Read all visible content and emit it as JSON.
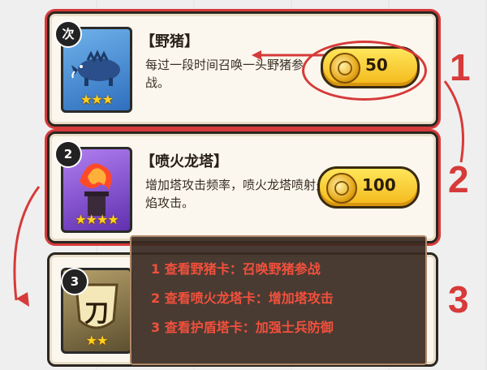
{
  "cards": [
    {
      "badge": "次",
      "title": "【野猪】",
      "desc": "每过一段时间召唤一头野猪参战。",
      "price": "50",
      "stars": "★★★",
      "step_number": "1"
    },
    {
      "badge": "2",
      "title": "【喷火龙塔】",
      "desc": "增加塔攻击频率，喷火龙塔喷射火焰攻击。",
      "price": "100",
      "stars": "★★★★",
      "step_number": "2"
    },
    {
      "badge": "3",
      "portrait_glyph": "刀",
      "stars": "★★",
      "step_number": "3"
    }
  ],
  "tooltip": {
    "lines": [
      "1  查看野猪卡：召唤野猪参战",
      "2  查看喷火龙塔卡：增加塔攻击",
      "3  查看护盾塔卡：加强士兵防御"
    ]
  },
  "colors": {
    "highlight_red": "#d63a3a",
    "coin_button": "#f3b81a"
  },
  "icons": [
    "boar-icon",
    "fire-tower-icon",
    "shield-icon",
    "coin-icon"
  ]
}
